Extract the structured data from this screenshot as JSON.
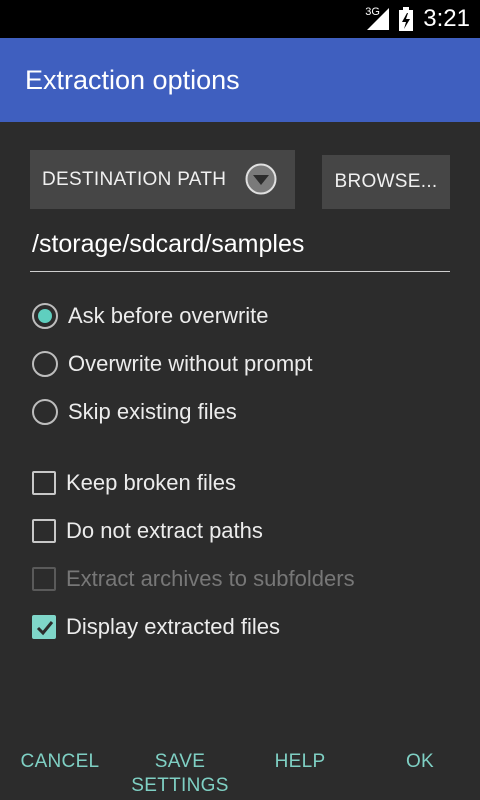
{
  "statusbar": {
    "network": "3G",
    "time": "3:21",
    "icons": [
      "signal-icon",
      "battery-icon"
    ]
  },
  "dialog": {
    "title": "Extraction options"
  },
  "destination": {
    "spinner_label": "DESTINATION PATH",
    "browse_label": "BROWSE...",
    "path_value": "/storage/sdcard/samples"
  },
  "overwrite_options": [
    {
      "label": "Ask before overwrite",
      "checked": true
    },
    {
      "label": "Overwrite without prompt",
      "checked": false
    },
    {
      "label": "Skip existing files",
      "checked": false
    }
  ],
  "checkboxes": [
    {
      "label": "Keep broken files",
      "checked": false,
      "enabled": true
    },
    {
      "label": "Do not extract paths",
      "checked": false,
      "enabled": true
    },
    {
      "label": "Extract archives to subfolders",
      "checked": false,
      "enabled": false
    },
    {
      "label": "Display extracted files",
      "checked": true,
      "enabled": true
    }
  ],
  "buttons": {
    "cancel": "CANCEL",
    "save_line1": "SAVE",
    "save_line2": "SETTINGS",
    "help": "HELP",
    "ok": "OK"
  },
  "colors": {
    "titlebar": "#3f5fbf",
    "accent": "#7fd0c4",
    "background": "#2c2c2c"
  }
}
